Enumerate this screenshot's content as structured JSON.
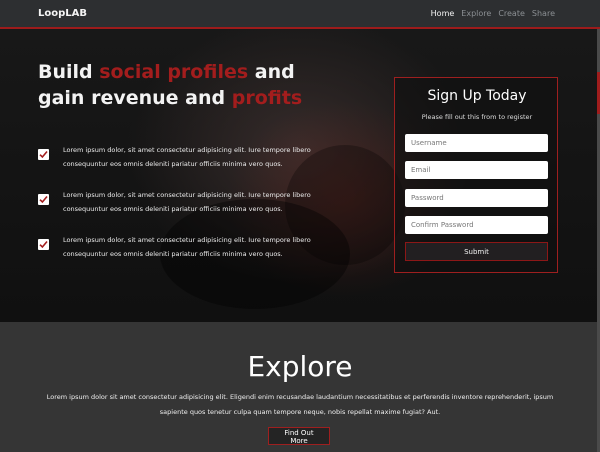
{
  "app": {
    "brand": "LoopLAB"
  },
  "nav": {
    "items": [
      {
        "label": "Home",
        "active": true
      },
      {
        "label": "Explore"
      },
      {
        "label": "Create"
      },
      {
        "label": "Share"
      }
    ]
  },
  "hero": {
    "headline": {
      "part1": "Build ",
      "accent1": "social profiles",
      "part2": " and gain revenue and ",
      "accent2": "profits"
    },
    "features": [
      {
        "text": "Lorem ipsum dolor, sit amet consectetur adipisicing elit. Iure tempore libero consequuntur eos omnis deleniti pariatur officiis minima vero quos."
      },
      {
        "text": "Lorem ipsum dolor, sit amet consectetur adipisicing elit. Iure tempore libero consequuntur eos omnis deleniti pariatur officiis minima vero quos."
      },
      {
        "text": "Lorem ipsum dolor, sit amet consectetur adipisicing elit. Iure tempore libero consequuntur eos omnis deleniti pariatur officiis minima vero quos."
      }
    ]
  },
  "signup": {
    "title": "Sign Up Today",
    "subtitle": "Please fill out this from to register",
    "fields": {
      "username": "Username",
      "email": "Email",
      "password": "Password",
      "confirm_password": "Confirm Password"
    },
    "submit_label": "Submit"
  },
  "explore": {
    "title": "Explore",
    "text": "Lorem ipsum dolor sit amet consectetur adipisicing elit. Eligendi enim recusandae laudantium necessitatibus et perferendis inventore reprehenderit, ipsum sapiente quos tenetur culpa quam tempore neque, nobis repellat maxime fugiat? Aut.",
    "button_label": "Find Out More"
  },
  "colors": {
    "accent": "#a31d1d",
    "navbar": "#2d2f31",
    "section_bg": "#353535"
  },
  "icons": {
    "check": "check-icon"
  }
}
